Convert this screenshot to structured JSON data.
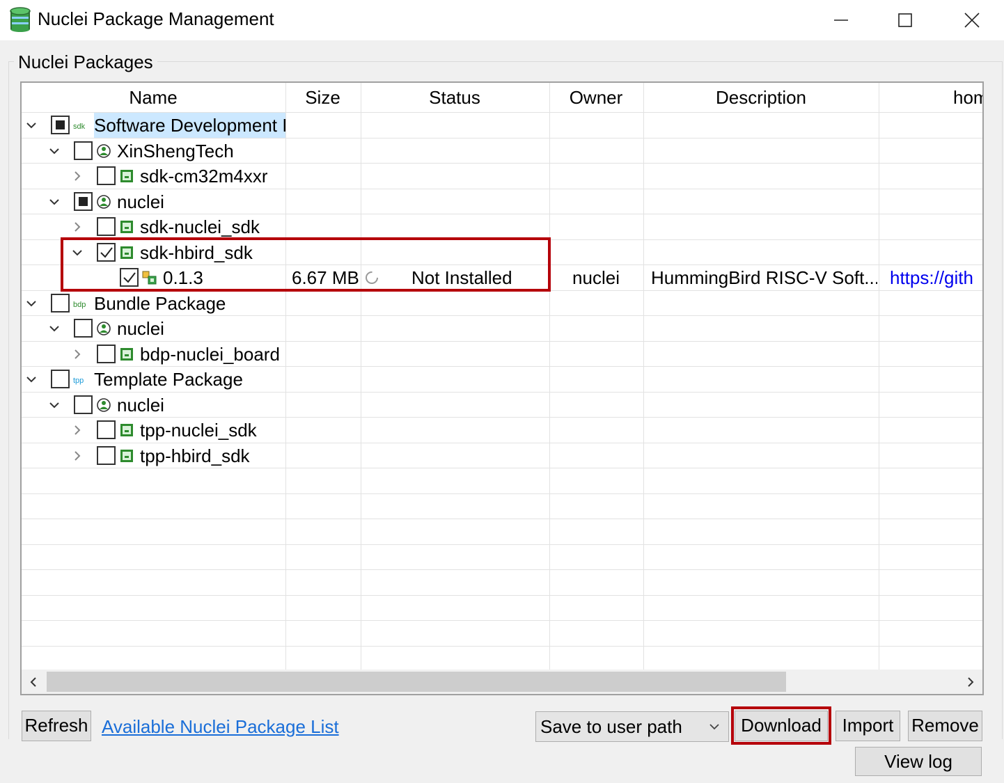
{
  "window": {
    "title": "Nuclei Package Management",
    "icon": "database-icon"
  },
  "group": {
    "title": "Nuclei Packages"
  },
  "table": {
    "columns": [
      "Name",
      "Size",
      "Status",
      "Owner",
      "Description",
      "hom"
    ],
    "rows": [
      {
        "label": "Software Development I",
        "icon": "sdk-category-icon",
        "icon_text": "sdk",
        "expanded": true,
        "check": "partial"
      },
      {
        "label": "XinShengTech",
        "icon": "owner-icon",
        "expanded": true,
        "check": "unchecked"
      },
      {
        "label": "sdk-cm32m4xxr",
        "icon": "package-icon",
        "expanded": false,
        "check": "unchecked"
      },
      {
        "label": "nuclei",
        "icon": "owner-icon",
        "expanded": true,
        "check": "partial"
      },
      {
        "label": "sdk-nuclei_sdk",
        "icon": "package-icon",
        "expanded": false,
        "check": "unchecked"
      },
      {
        "label": "sdk-hbird_sdk",
        "icon": "package-icon",
        "expanded": true,
        "check": "checked"
      },
      {
        "label": "0.1.3",
        "icon": "version-icon",
        "check": "checked",
        "size": "6.67 MB",
        "status": "Not Installed",
        "owner": "nuclei",
        "description": "HummingBird RISC-V Soft...",
        "home": "https://gith"
      },
      {
        "label": "Bundle Package",
        "icon": "bdp-category-icon",
        "icon_text": "bdp",
        "expanded": true,
        "check": "unchecked"
      },
      {
        "label": "nuclei",
        "icon": "owner-icon",
        "expanded": true,
        "check": "unchecked"
      },
      {
        "label": "bdp-nuclei_board",
        "icon": "package-icon",
        "expanded": false,
        "check": "unchecked"
      },
      {
        "label": "Template Package",
        "icon": "tpp-category-icon",
        "icon_text": "tpp",
        "expanded": true,
        "check": "unchecked"
      },
      {
        "label": "nuclei",
        "icon": "owner-icon",
        "expanded": true,
        "check": "unchecked"
      },
      {
        "label": "tpp-nuclei_sdk",
        "icon": "package-icon",
        "expanded": false,
        "check": "unchecked"
      },
      {
        "label": "tpp-hbird_sdk",
        "icon": "package-icon",
        "expanded": false,
        "check": "unchecked"
      }
    ]
  },
  "controls": {
    "refresh_label": "Refresh",
    "package_list_link": "Available Nuclei Package List",
    "save_path_value": "Save to user path",
    "download_label": "Download",
    "import_label": "Import",
    "remove_label": "Remove",
    "view_log_label": "View log"
  },
  "colors": {
    "highlight": "#b5000a",
    "link": "#1a6ed8",
    "package_green": "#2e8b2e",
    "selection": "#cce8ff"
  }
}
